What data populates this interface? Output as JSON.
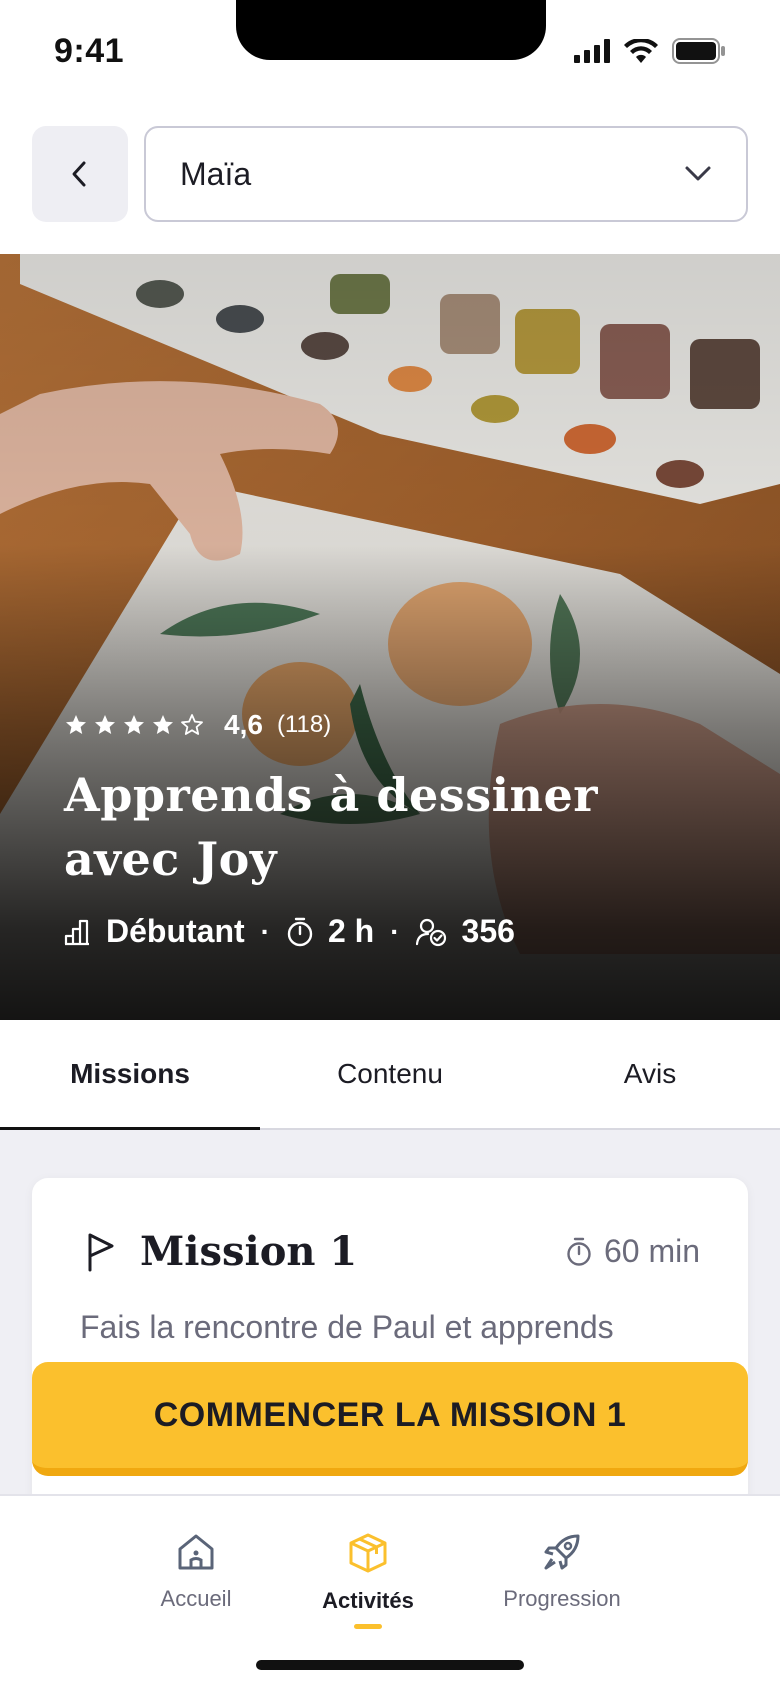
{
  "status_bar": {
    "time": "9:41"
  },
  "header": {
    "selected_child": "Maïa"
  },
  "course": {
    "rating_value": "4,6",
    "rating_count": "(118)",
    "rating_stars": 4,
    "title": "Apprends à dessiner avec Joy",
    "level": "Débutant",
    "duration": "2 h",
    "participants": "356"
  },
  "tabs": [
    {
      "label": "Missions",
      "active": true
    },
    {
      "label": "Contenu",
      "active": false
    },
    {
      "label": "Avis",
      "active": false
    }
  ],
  "mission": {
    "title": "Mission 1",
    "duration": "60 min",
    "description": "Fais la rencontre de Paul et apprends"
  },
  "cta": {
    "label": "COMMENCER LA MISSION 1"
  },
  "bottom_nav": [
    {
      "label": "Accueil",
      "icon": "house-icon",
      "active": false
    },
    {
      "label": "Activités",
      "icon": "box-icon",
      "active": true
    },
    {
      "label": "Progression",
      "icon": "rocket-icon",
      "active": false
    }
  ],
  "colors": {
    "accent": "#fbc02d",
    "text_muted": "#6b6b7b",
    "tab_bg": "#efeff4"
  }
}
